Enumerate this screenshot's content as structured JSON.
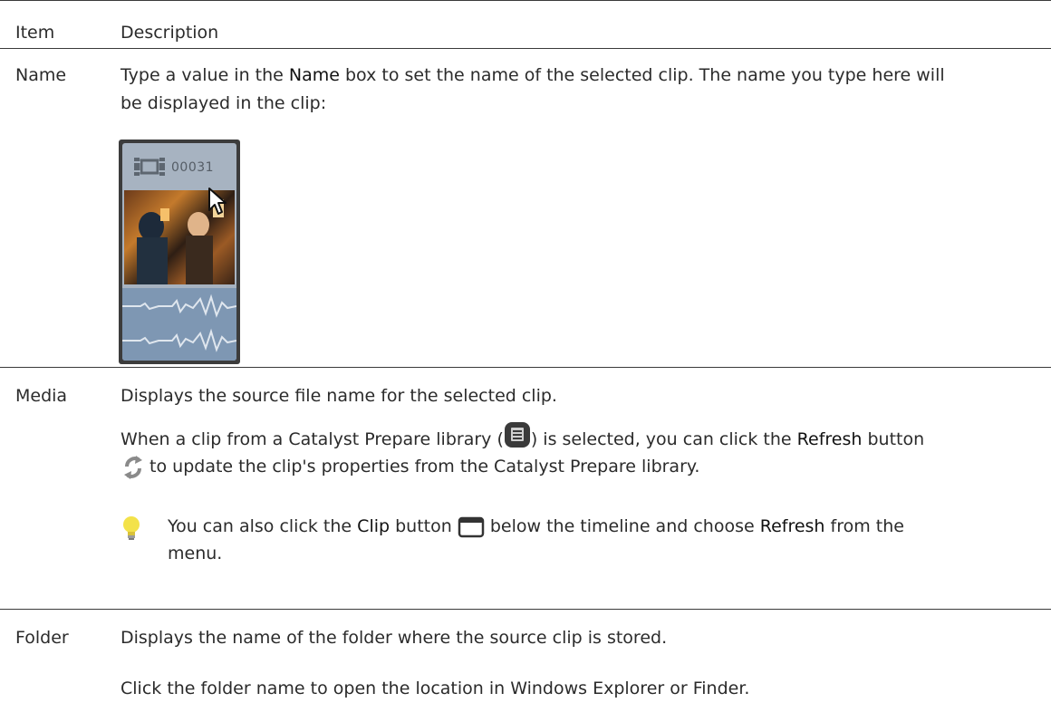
{
  "table": {
    "header": {
      "item": "Item",
      "description": "Description"
    },
    "name": {
      "item": "Name",
      "desc_pre": "Type a value in the ",
      "desc_bold": "Name",
      "desc_post": " box to set the name of the selected clip. The name you type here will",
      "desc_line2": "be displayed in the clip:",
      "clip_label": "00031"
    },
    "media": {
      "item": "Media",
      "p1": "Displays the source file name for the selected clip.",
      "p2_a": "When a clip from a Catalyst Prepare library (",
      "p2_b": ") is selected, you can click the ",
      "p2_bold": "Refresh",
      "p2_c": " button",
      "p2_d": " to update the clip's properties from the Catalyst Prepare library.",
      "tip_a": "You can also click the ",
      "tip_bold1": "Clip",
      "tip_b": " button ",
      "tip_c": " below the timeline and choose ",
      "tip_bold2": "Refresh",
      "tip_d": " from the",
      "tip_line2": "menu."
    },
    "folder": {
      "item": "Folder",
      "p1": "Displays the name of the folder where the source clip is stored.",
      "p2": "Click the folder name to open the location in Windows Explorer or Finder."
    }
  },
  "icons": [
    "film-strip-icon",
    "mouse-cursor-icon",
    "library-icon",
    "refresh-icon",
    "lightbulb-tip-icon",
    "clip-button-icon"
  ]
}
